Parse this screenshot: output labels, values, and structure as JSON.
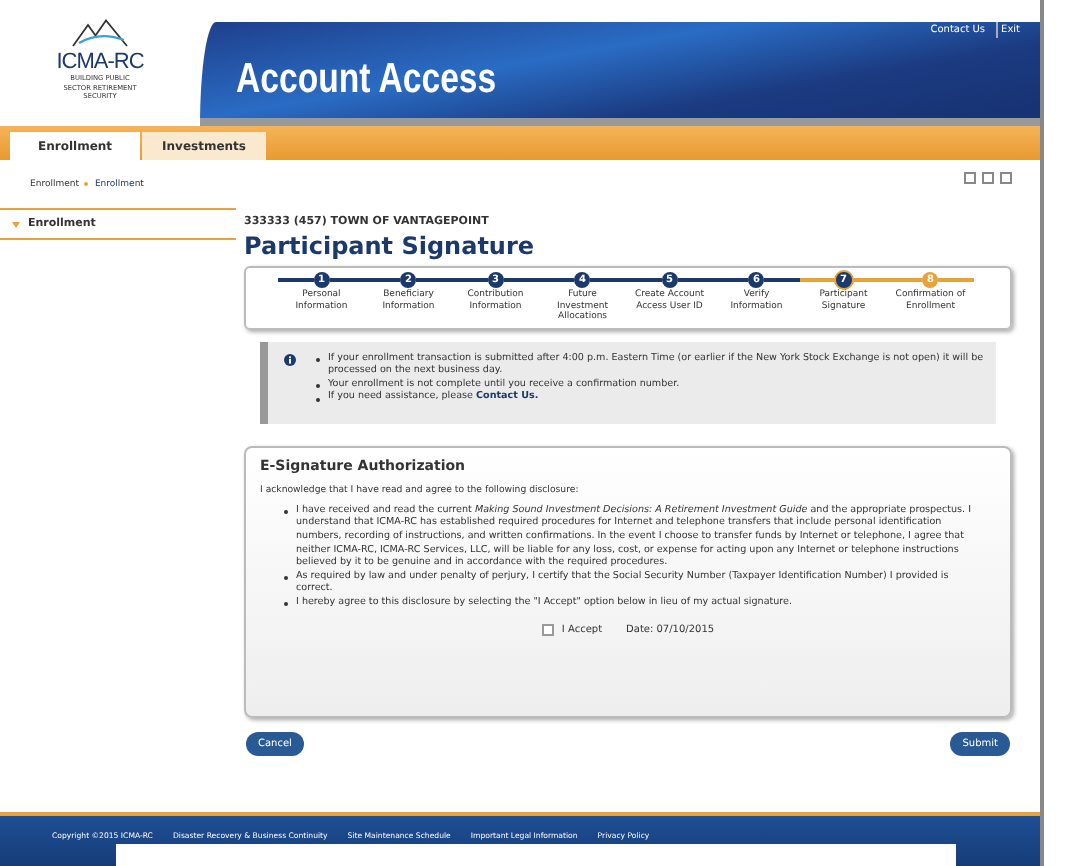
{
  "header": {
    "logo_name": "ICMA-RC",
    "logo_tagline": "BUILDING PUBLIC SECTOR RETIREMENT SECURITY",
    "title": "Account Access",
    "links": [
      "Contact Us",
      "Exit"
    ]
  },
  "tabs": [
    {
      "label": "Enrollment",
      "selected": true
    },
    {
      "label": "Investments",
      "selected": false
    }
  ],
  "breadcrumb": [
    "Enrollment",
    "Enrollment"
  ],
  "sidebar": {
    "items": [
      {
        "label": "Enrollment",
        "selected": true
      }
    ]
  },
  "account": "333333 (457) TOWN OF VANTAGEPOINT",
  "page_title": "Participant Signature",
  "steps": [
    {
      "number": "1",
      "label": "Personal Information",
      "completed": true,
      "current": false
    },
    {
      "number": "2",
      "label": "Beneficiary Information",
      "completed": true,
      "current": false
    },
    {
      "number": "3",
      "label": "Contribution Information",
      "completed": true,
      "current": false
    },
    {
      "number": "4",
      "label": "Future Investment Allocations",
      "completed": true,
      "current": false
    },
    {
      "number": "5",
      "label": "Create Account Access User ID",
      "completed": true,
      "current": false
    },
    {
      "number": "6",
      "label": "Verify Information",
      "completed": true,
      "current": false
    },
    {
      "number": "7",
      "label": "Participant Signature",
      "completed": false,
      "current": true
    },
    {
      "number": "8",
      "label": "Confirmation of Enrollment",
      "completed": false,
      "current": false
    }
  ],
  "notice": {
    "items": [
      "If your enrollment transaction is submitted after 4:00 p.m. Eastern Time (or earlier if the New York Stock Exchange is not open) it will be processed on the next business day.",
      "Your enrollment is not complete until you receive a confirmation number."
    ],
    "assist_text": "If you need assistance, please",
    "assist_link": "Contact Us."
  },
  "esignature": {
    "title": "E-Signature Authorization",
    "intro": "I acknowledge that I have read and agree to the following disclosure:",
    "items": [
      "I have received and read the current *Making Sound Investment Decisions: A Retirement Investment Guide* and the appropriate prospectus. I understand that ICMA-RC has established required procedures for Internet and telephone transfers that include personal identification numbers, recording of instructions, and written confirmations. In the event I choose to transfer funds by Internet or telephone, I agree that neither ICMA-RC, ICMA-RC Services, LLC, will be liable for any loss, cost, or expense for acting upon any Internet or telephone instructions believed by it to be genuine and in accordance with the required procedures.",
      "As required by law and under penalty of perjury, I certify that the Social Security Number (Taxpayer Identification Number) I provided is correct.",
      "I hereby agree to this disclosure by selecting the \"I Accept\" option below in lieu of my actual signature."
    ],
    "accept_label": "I Accept",
    "accepted": false,
    "date": "Date: 07/10/2015"
  },
  "buttons": {
    "cancel": "Cancel",
    "submit": "Submit"
  },
  "footer": [
    "Copyright ©2015 ICMA-RC",
    "Disaster Recovery & Business Continuity",
    "Site Maintenance Schedule",
    "Important Legal Information",
    "Privacy Policy"
  ]
}
